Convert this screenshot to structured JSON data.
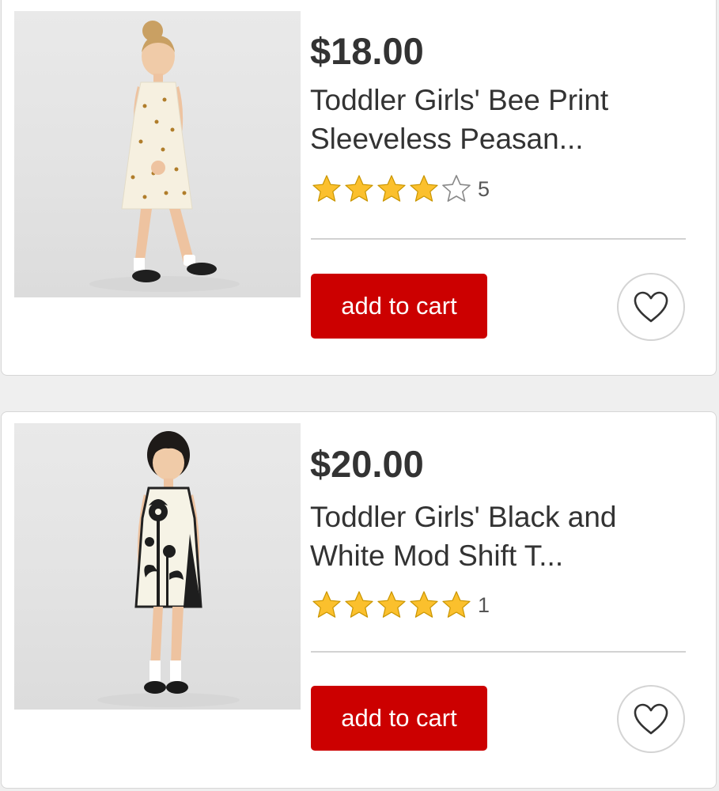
{
  "colors": {
    "accent": "#cc0000",
    "star": "#fbc02d",
    "text": "#333333"
  },
  "products": [
    {
      "price": "$18.00",
      "title_line1": "Toddler Girls' Bee Print",
      "title_line2": "Sleeveless Peasan...",
      "rating": 4,
      "rating_max": 5,
      "review_count": "5",
      "add_label": "add to cart",
      "favorite_icon": "heart-outline-icon",
      "image": "Toddler girl in white bee-print sleeveless dress"
    },
    {
      "price": "$20.00",
      "title_line1": "Toddler Girls' Black and",
      "title_line2": "White Mod Shift T...",
      "rating": 5,
      "rating_max": 5,
      "review_count": "1",
      "add_label": "add to cart",
      "favorite_icon": "heart-outline-icon",
      "image": "Toddler girl in black and white mod shift dress"
    }
  ]
}
